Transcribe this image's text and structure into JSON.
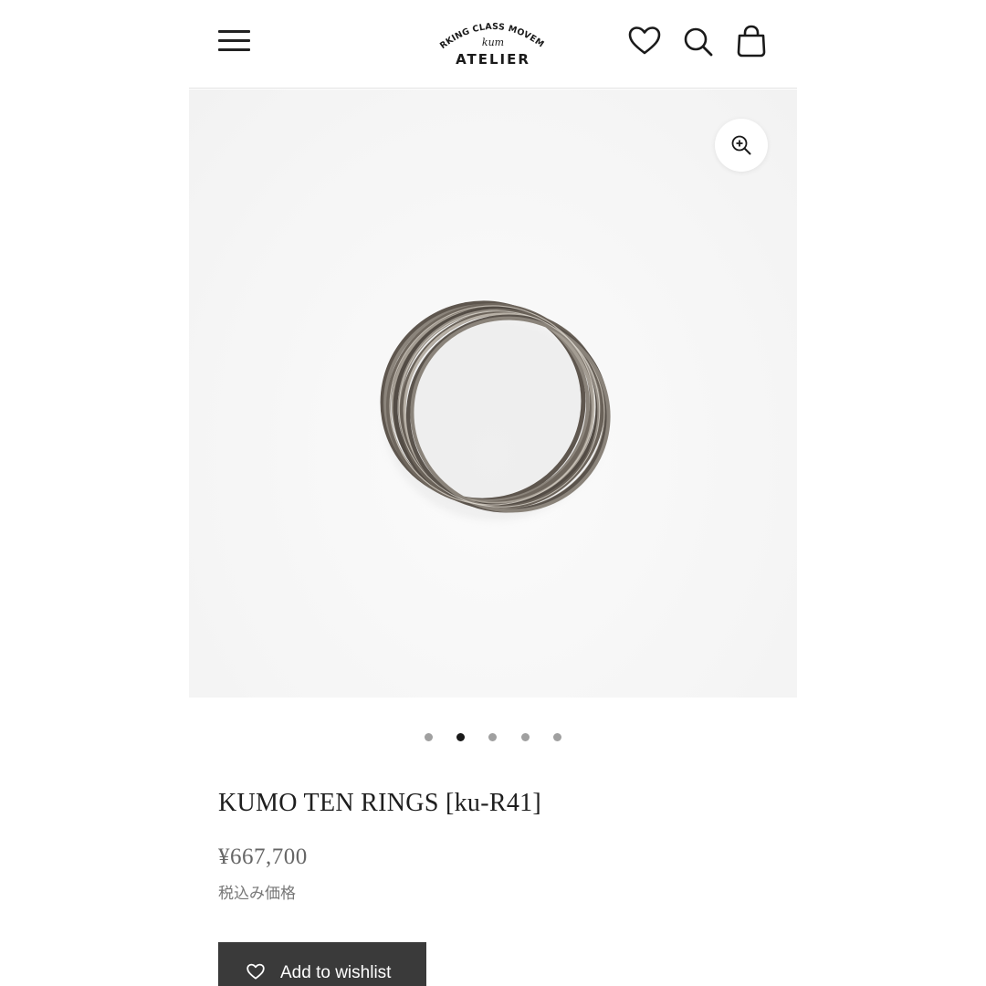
{
  "header": {
    "logo": {
      "arc_text": "WORKING CLASS MOVEMENT",
      "script_text": "kum",
      "wordmark": "ATELIER"
    },
    "icons": [
      "menu-icon",
      "heart-icon",
      "search-icon",
      "bag-icon"
    ]
  },
  "gallery": {
    "zoom_icon": "zoom-in-icon",
    "image_subject": "silver intertwined ten-band ring",
    "slide_count": 5,
    "active_slide": 2
  },
  "product": {
    "title": "KUMO TEN RINGS [ku-R41]",
    "price": "¥667,700",
    "tax_note": "税込み価格"
  },
  "actions": {
    "wishlist_label": "Add to wishlist"
  },
  "colors": {
    "button_bg": "#3a3a3a",
    "active_dot": "#1a1a1a",
    "inactive_dot": "#a0a0a0"
  }
}
